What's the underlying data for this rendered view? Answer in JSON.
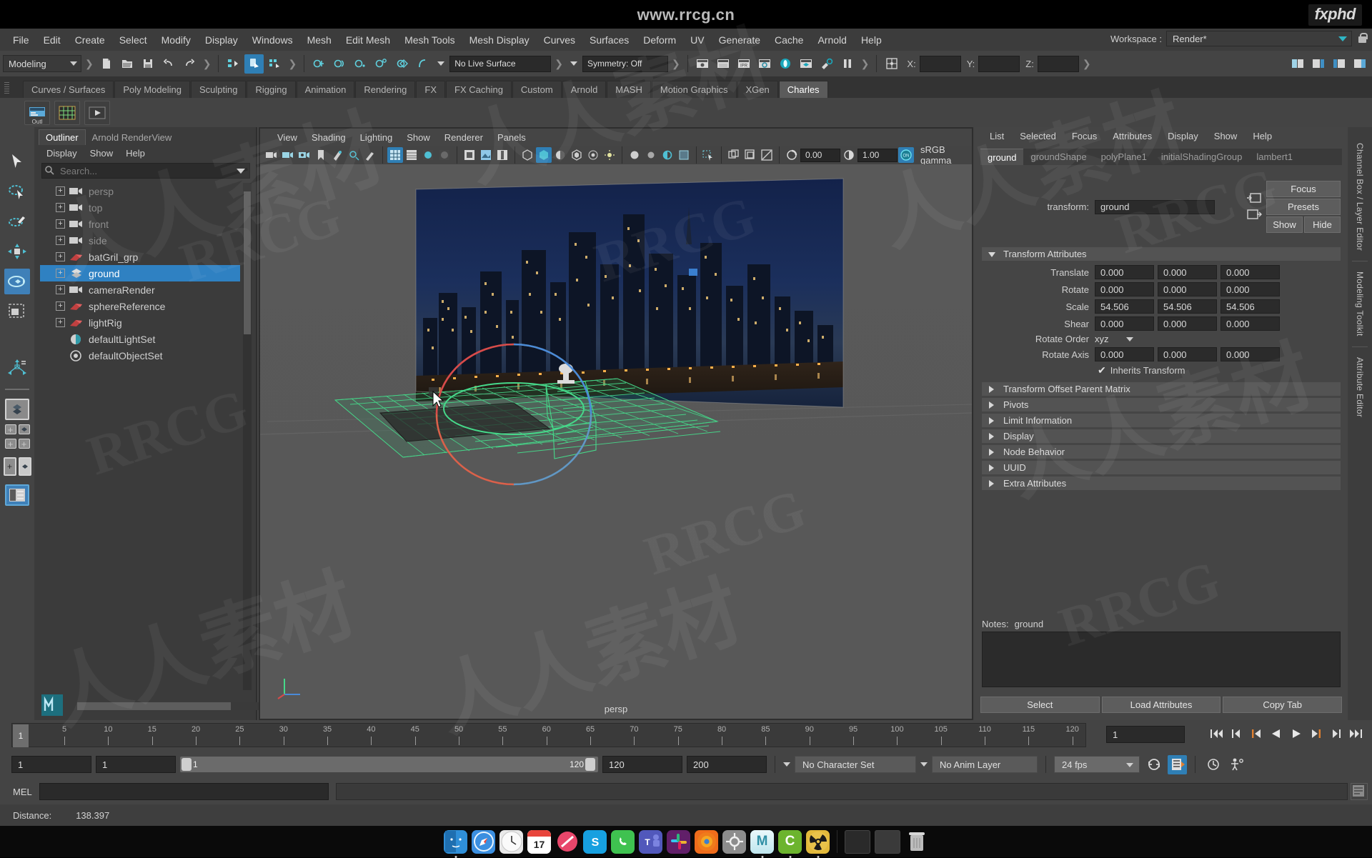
{
  "titlebar": {
    "site": "www.rrcg.cn",
    "brand": "fxphd"
  },
  "menubar": {
    "items": [
      "File",
      "Edit",
      "Create",
      "Select",
      "Modify",
      "Display",
      "Windows",
      "Mesh",
      "Edit Mesh",
      "Mesh Tools",
      "Mesh Display",
      "Curves",
      "Surfaces",
      "Deform",
      "UV",
      "Generate",
      "Cache",
      "Arnold",
      "Help"
    ],
    "workspace_label": "Workspace :",
    "workspace_value": "Render*"
  },
  "statusline": {
    "mode": "Modeling",
    "live_surface": "No Live Surface",
    "symmetry": "Symmetry: Off",
    "x_label": "X:",
    "y_label": "Y:",
    "z_label": "Z:",
    "x_value": "",
    "y_value": "",
    "z_value": ""
  },
  "shelf": {
    "tabs": [
      "Curves / Surfaces",
      "Poly Modeling",
      "Sculpting",
      "Rigging",
      "Animation",
      "Rendering",
      "FX",
      "FX Caching",
      "Custom",
      "Arnold",
      "MASH",
      "Motion Graphics",
      "XGen",
      "Charles"
    ],
    "active_tab": "Charles",
    "buttons": [
      {
        "name": "outliner-shelf-icon",
        "caption": "Outl"
      },
      {
        "name": "grid-shelf-icon",
        "caption": ""
      },
      {
        "name": "playblast-shelf-icon",
        "caption": ""
      }
    ]
  },
  "outliner": {
    "tabs": [
      {
        "label": "Outliner",
        "active": true
      },
      {
        "label": "Arnold RenderView",
        "active": false
      }
    ],
    "menus": [
      "Display",
      "Show",
      "Help"
    ],
    "search_placeholder": "Search...",
    "items": [
      {
        "label": "persp",
        "icon": "camera-icon",
        "dim": true,
        "selected": false
      },
      {
        "label": "top",
        "icon": "camera-icon",
        "dim": true,
        "selected": false
      },
      {
        "label": "front",
        "icon": "camera-icon",
        "dim": true,
        "selected": false
      },
      {
        "label": "side",
        "icon": "camera-icon",
        "dim": true,
        "selected": false
      },
      {
        "label": "batGril_grp",
        "icon": "group-icon",
        "dim": false,
        "selected": false
      },
      {
        "label": "ground",
        "icon": "mesh-icon",
        "dim": false,
        "selected": true
      },
      {
        "label": "cameraRender",
        "icon": "camera-icon",
        "dim": false,
        "selected": false
      },
      {
        "label": "sphereReference",
        "icon": "group-icon",
        "dim": false,
        "selected": false
      },
      {
        "label": "lightRig",
        "icon": "group-icon",
        "dim": false,
        "selected": false
      },
      {
        "label": "defaultLightSet",
        "icon": "lightset-icon",
        "dim": false,
        "selected": false
      },
      {
        "label": "defaultObjectSet",
        "icon": "objectset-icon",
        "dim": false,
        "selected": false
      }
    ]
  },
  "viewport": {
    "menus": [
      "View",
      "Shading",
      "Lighting",
      "Show",
      "Renderer",
      "Panels"
    ],
    "exposure": "0.00",
    "gamma": "1.00",
    "color_mgmt_state": "ON",
    "color_profile": "sRGB gamma",
    "camera_label": "persp"
  },
  "attribute_editor": {
    "menus": [
      "List",
      "Selected",
      "Focus",
      "Attributes",
      "Display",
      "Show",
      "Help"
    ],
    "tabs": [
      {
        "label": "ground",
        "active": true
      },
      {
        "label": "groundShape",
        "active": false
      },
      {
        "label": "polyPlane1",
        "active": false
      },
      {
        "label": "initialShadingGroup",
        "active": false
      },
      {
        "label": "lambert1",
        "active": false
      }
    ],
    "transform_label": "transform:",
    "transform_value": "ground",
    "side_buttons": [
      "Focus",
      "Presets"
    ],
    "show_label": "Show",
    "hide_label": "Hide",
    "section_title": "Transform Attributes",
    "attributes": [
      {
        "label": "Translate",
        "values": [
          "0.000",
          "0.000",
          "0.000"
        ]
      },
      {
        "label": "Rotate",
        "values": [
          "0.000",
          "0.000",
          "0.000"
        ]
      },
      {
        "label": "Scale",
        "values": [
          "54.506",
          "54.506",
          "54.506"
        ]
      },
      {
        "label": "Shear",
        "values": [
          "0.000",
          "0.000",
          "0.000"
        ]
      }
    ],
    "rotate_order_label": "Rotate Order",
    "rotate_order_value": "xyz",
    "rotate_axis_label": "Rotate Axis",
    "rotate_axis_values": [
      "0.000",
      "0.000",
      "0.000"
    ],
    "inherits_transform_label": "Inherits Transform",
    "inherits_transform_checked": true,
    "collapsed_sections": [
      "Transform Offset Parent Matrix",
      "Pivots",
      "Limit Information",
      "Display",
      "Node Behavior",
      "UUID",
      "Extra Attributes"
    ],
    "notes_label": "Notes:",
    "notes_value": "ground",
    "footer_buttons": [
      "Select",
      "Load Attributes",
      "Copy Tab"
    ]
  },
  "right_strip": {
    "tabs": [
      "Channel Box / Layer Editor",
      "Modeling Toolkit",
      "Attribute Editor"
    ]
  },
  "timeline": {
    "ticks": [
      5,
      10,
      15,
      20,
      25,
      30,
      35,
      40,
      45,
      50,
      55,
      60,
      65,
      70,
      75,
      80,
      85,
      90,
      95,
      100,
      105,
      110,
      115,
      120
    ],
    "current_frame": "1",
    "current_frame_field": "1",
    "range_start": "1",
    "range_end": "1",
    "playback_min": "1",
    "playback_max": "120",
    "anim_end": "120",
    "anim_max": "200",
    "character_set": "No Character Set",
    "anim_layer": "No Anim Layer",
    "fps": "24 fps"
  },
  "command_line": {
    "label": "MEL",
    "value": ""
  },
  "status_bar": {
    "distance_label": "Distance:",
    "distance_value": "138.397"
  },
  "dock": {
    "apps": [
      {
        "name": "finder",
        "label": "",
        "color": "#2f8fd8"
      },
      {
        "name": "safari",
        "label": "",
        "color": "#3b8fe0"
      },
      {
        "name": "clock",
        "label": "",
        "color": "#e9e9e9"
      },
      {
        "name": "calendar",
        "label": "17",
        "color": "#ffffff"
      },
      {
        "name": "no-entry",
        "label": "",
        "color": "#e8466a"
      },
      {
        "name": "skype",
        "label": "S",
        "color": "#17a0e0"
      },
      {
        "name": "whatsapp",
        "label": "",
        "color": "#3fc250"
      },
      {
        "name": "teams",
        "label": "T",
        "color": "#5158bb"
      },
      {
        "name": "slack",
        "label": "",
        "color": "#611f69"
      },
      {
        "name": "firefox",
        "label": "",
        "color": "#ef6c1b"
      },
      {
        "name": "preferences",
        "label": "",
        "color": "#8d8d8d"
      },
      {
        "name": "maya",
        "label": "M",
        "color": "#57c4d4"
      },
      {
        "name": "c-app",
        "label": "C",
        "color": "#6cb42e"
      },
      {
        "name": "nuke",
        "label": "",
        "color": "#e2b93b"
      },
      {
        "name": "window-1",
        "label": "",
        "color": "#2a2a2a"
      },
      {
        "name": "window-2",
        "label": "",
        "color": "#3a3a3a"
      },
      {
        "name": "trash",
        "label": "",
        "color": "#b9b9b9"
      }
    ]
  },
  "watermarks": {
    "text_a": "RRCG",
    "text_b": "人人素材"
  },
  "colors": {
    "accent_blue": "#2f81c2",
    "teal": "#2fb5c4",
    "panel_bg": "#444444",
    "dark_field": "#2a2a2a"
  }
}
